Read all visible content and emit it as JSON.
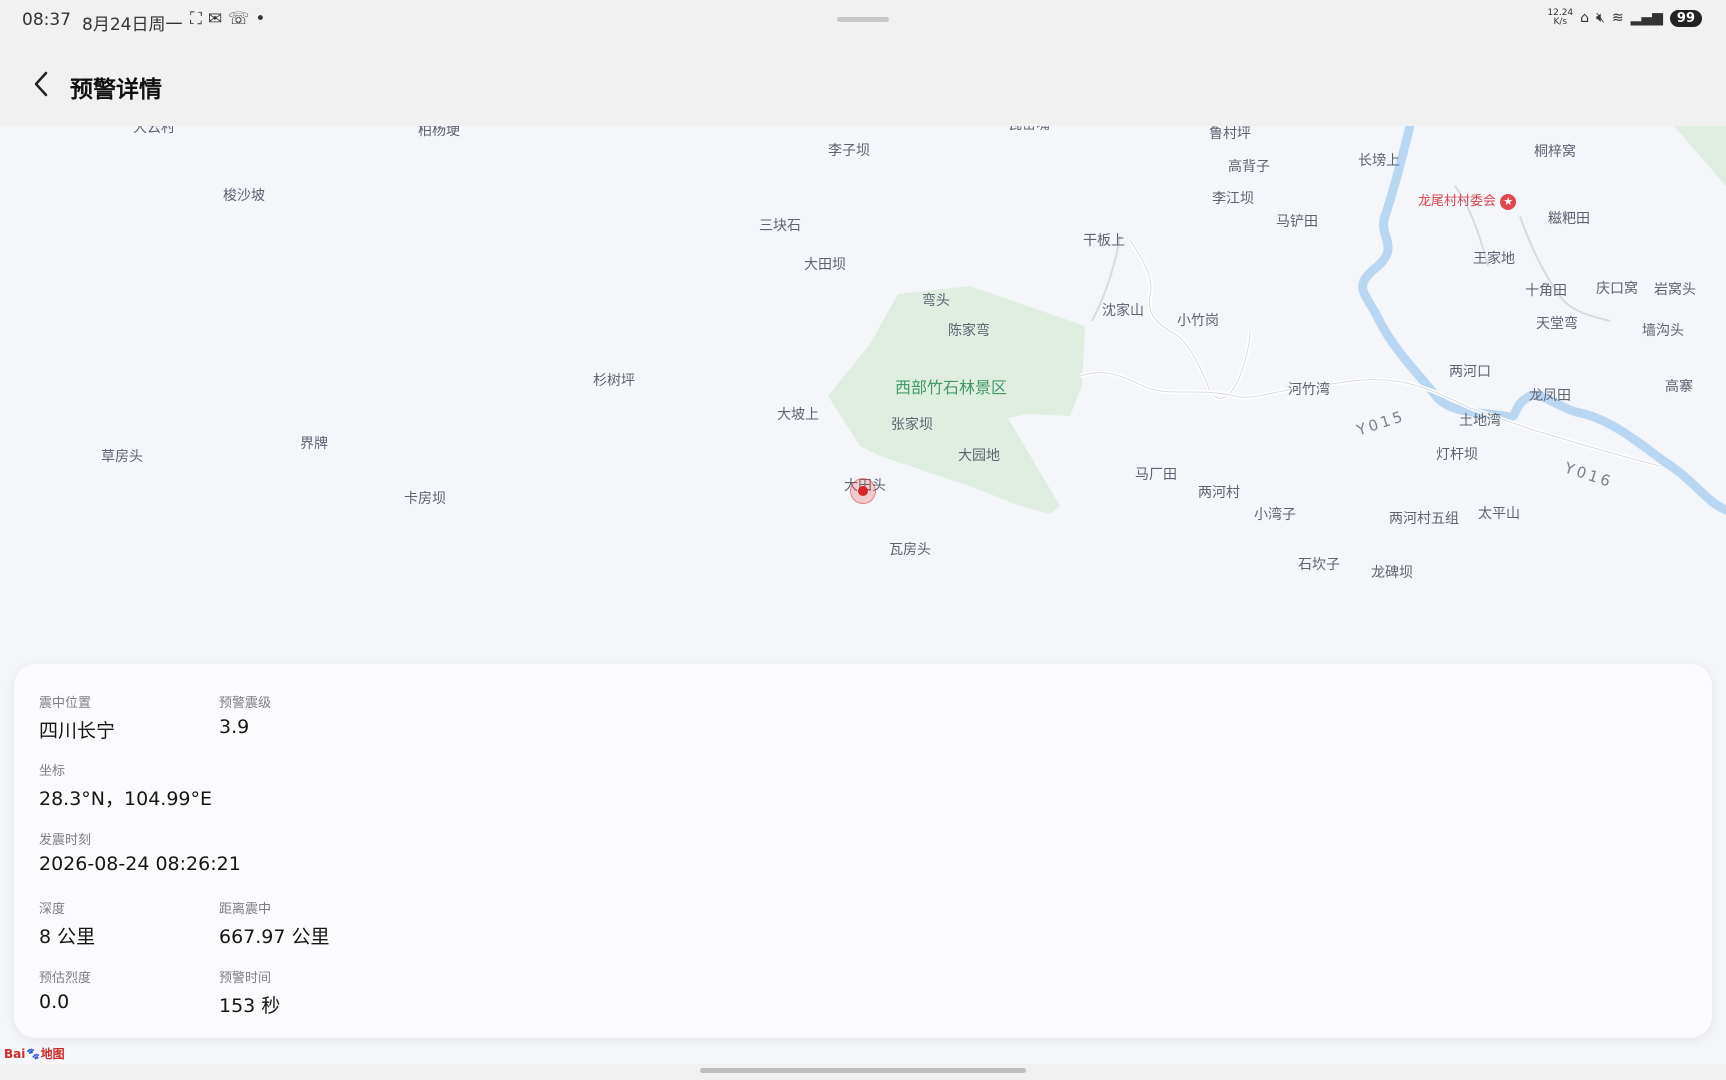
{
  "status_bar": {
    "time": "08:37",
    "date": "8月24日周一",
    "icons": [
      "screenshot-icon",
      "wechat-icon",
      "missed-call-icon",
      "dot-icon"
    ],
    "net_speed_value": "12.24",
    "net_speed_unit": "K/s",
    "right_icons": [
      "home-icon",
      "mute-icon",
      "wifi-icon",
      "signal-4g-icon"
    ],
    "battery": "99"
  },
  "header": {
    "title": "预警详情"
  },
  "map": {
    "labels": [
      "大云村",
      "柏杨埂",
      "瓦窑嘴",
      "鲁村坪",
      "高背子",
      "长塝上",
      "桐梓窝",
      "李子坝",
      "梭沙坡",
      "李江坝",
      "马铲田",
      "糍粑田",
      "三块石",
      "干板上",
      "大田坝",
      "王家地",
      "弯头",
      "十角田",
      "庆口窝",
      "岩窝头",
      "陈家弯",
      "沈家山",
      "小竹岗",
      "天堂弯",
      "墙沟头",
      "杉树坪",
      "河竹湾",
      "两河口",
      "高寨",
      "大坡上",
      "龙凤田",
      "张家坝",
      "土地湾",
      "界牌",
      "草房头",
      "灯杆坝",
      "大园地",
      "马厂田",
      "大田头",
      "两河村",
      "卡房坝",
      "小湾子",
      "两河村五组",
      "太平山",
      "瓦房头",
      "石坎子",
      "龙碑坝"
    ],
    "scenic_label": "西部竹石林景区",
    "poi_label": "龙尾村村委会",
    "road_labels": [
      "Y015",
      "Y016"
    ],
    "logo_text": "Bai",
    "logo_text2": "地图",
    "colors": {
      "water": "#b9d7f2",
      "green": "#e0eee2",
      "road": "#ffffff",
      "marker": "#d8262b"
    }
  },
  "info": {
    "epicenter_label": "震中位置",
    "epicenter_value": "四川长宁",
    "magnitude_label": "预警震级",
    "magnitude_value": "3.9",
    "coords_label": "坐标",
    "coords_value": "28.3°N，104.99°E",
    "time_label": "发震时刻",
    "time_value": "2026-08-24 08:26:21",
    "depth_label": "深度",
    "depth_value": "8 公里",
    "distance_label": "距离震中",
    "distance_value": "667.97 公里",
    "intensity_label": "预估烈度",
    "intensity_value": "0.0",
    "warning_time_label": "预警时间",
    "warning_time_value": "153 秒"
  }
}
